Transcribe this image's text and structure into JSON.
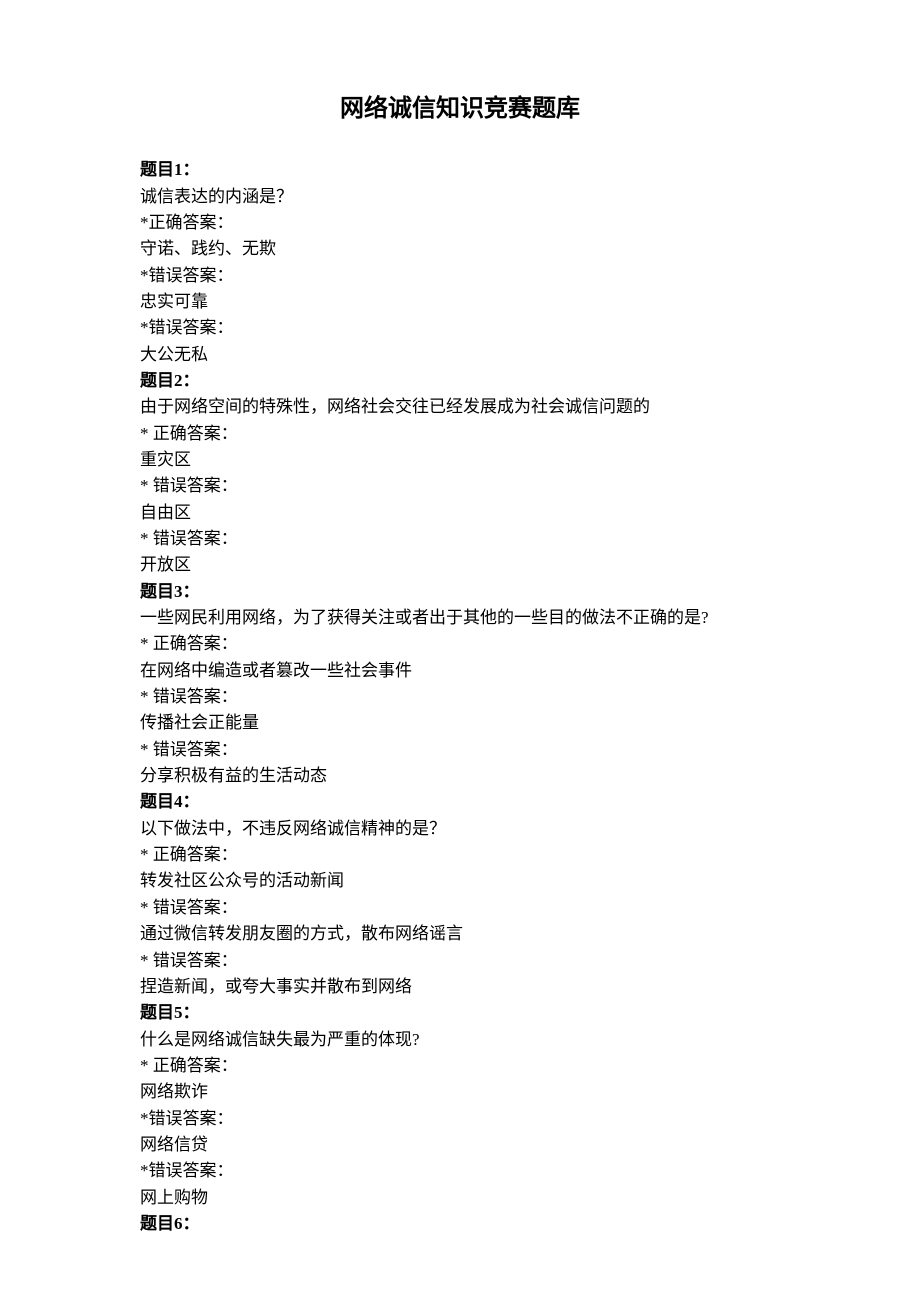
{
  "title": "网络诚信知识竞赛题库",
  "questions": [
    {
      "heading": "题目1：",
      "prompt": "诚信表达的内涵是？",
      "answers": [
        {
          "label": "*正确答案：",
          "text": "守诺、践约、无欺"
        },
        {
          "label": "*错误答案：",
          "text": "忠实可靠"
        },
        {
          "label": "*错误答案：",
          "text": "大公无私"
        }
      ]
    },
    {
      "heading": "题目2：",
      "prompt": "由于网络空间的特殊性，网络社会交往已经发展成为社会诚信问题的",
      "answers": [
        {
          "label": "* 正确答案：",
          "text": "重灾区"
        },
        {
          "label": "* 错误答案：",
          "text": "自由区"
        },
        {
          "label": "* 错误答案：",
          "text": "开放区"
        }
      ]
    },
    {
      "heading": "题目3：",
      "prompt": "一些网民利用网络，为了获得关注或者出于其他的一些目的做法不正确的是?",
      "answers": [
        {
          "label": "* 正确答案：",
          "text": "在网络中编造或者篡改一些社会事件"
        },
        {
          "label": "* 错误答案：",
          "text": "传播社会正能量"
        },
        {
          "label": "* 错误答案：",
          "text": "分享积极有益的生活动态"
        }
      ]
    },
    {
      "heading": "题目4：",
      "prompt": "以下做法中，不违反网络诚信精神的是？",
      "answers": [
        {
          "label": "* 正确答案：",
          "text": "转发社区公众号的活动新闻"
        },
        {
          "label": "* 错误答案：",
          "text": "通过微信转发朋友圈的方式，散布网络谣言"
        },
        {
          "label": "* 错误答案：",
          "text": "捏造新闻，或夸大事实并散布到网络"
        }
      ]
    },
    {
      "heading": "题目5：",
      "prompt": "什么是网络诚信缺失最为严重的体现?",
      "answers": [
        {
          "label": "* 正确答案：",
          "text": "网络欺诈"
        },
        {
          "label": "*错误答案：",
          "text": "网络信贷"
        },
        {
          "label": "*错误答案：",
          "text": "网上购物"
        }
      ]
    },
    {
      "heading": "题目6：",
      "prompt": "",
      "answers": []
    }
  ]
}
